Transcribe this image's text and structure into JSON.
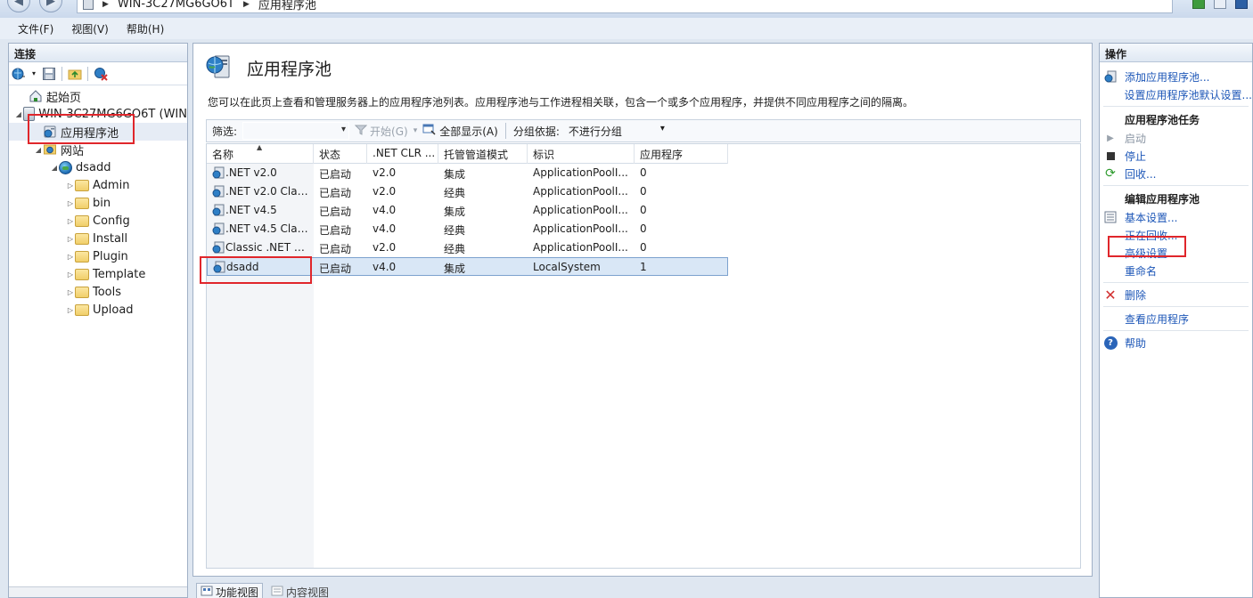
{
  "address": {
    "segments": [
      "WIN-3C27MG6GO6T",
      "应用程序池"
    ]
  },
  "menu": [
    "文件(F)",
    "视图(V)",
    "帮助(H)"
  ],
  "connections": {
    "title": "连接",
    "tree": {
      "start_page": "起始页",
      "server": "WIN-3C27MG6GO6T (WIN",
      "app_pools": "应用程序池",
      "sites": "网站",
      "site_name": "dsadd",
      "folders": [
        "Admin",
        "bin",
        "Config",
        "Install",
        "Plugin",
        "Template",
        "Tools",
        "Upload"
      ]
    }
  },
  "center": {
    "title": "应用程序池",
    "description": "您可以在此页上查看和管理服务器上的应用程序池列表。应用程序池与工作进程相关联，包含一个或多个应用程序，并提供不同应用程序之间的隔离。",
    "filter": {
      "label": "筛选:",
      "go": "开始(G)",
      "show_all": "全部显示(A)",
      "group_by_label": "分组依据:",
      "group_by_value": "不进行分组"
    },
    "columns": [
      "名称",
      "状态",
      ".NET CLR ...",
      "托管管道模式",
      "标识",
      "应用程序"
    ],
    "rows": [
      {
        "name": ".NET v2.0",
        "status": "已启动",
        "clr": "v2.0",
        "pipeline": "集成",
        "identity": "ApplicationPoolI...",
        "apps": "0"
      },
      {
        "name": ".NET v2.0 Clas...",
        "status": "已启动",
        "clr": "v2.0",
        "pipeline": "经典",
        "identity": "ApplicationPoolI...",
        "apps": "0"
      },
      {
        "name": ".NET v4.5",
        "status": "已启动",
        "clr": "v4.0",
        "pipeline": "集成",
        "identity": "ApplicationPoolI...",
        "apps": "0"
      },
      {
        "name": ".NET v4.5 Clas...",
        "status": "已启动",
        "clr": "v4.0",
        "pipeline": "经典",
        "identity": "ApplicationPoolI...",
        "apps": "0"
      },
      {
        "name": "Classic .NET A...",
        "status": "已启动",
        "clr": "v2.0",
        "pipeline": "经典",
        "identity": "ApplicationPoolI...",
        "apps": "0"
      },
      {
        "name": "dsadd",
        "status": "已启动",
        "clr": "v4.0",
        "pipeline": "集成",
        "identity": "LocalSystem",
        "apps": "1"
      }
    ],
    "selected_row": "dsadd",
    "tabs": {
      "features": "功能视图",
      "content": "内容视图"
    }
  },
  "actions": {
    "title": "操作",
    "add_pool": "添加应用程序池...",
    "set_defaults": "设置应用程序池默认设置...",
    "tasks_header": "应用程序池任务",
    "start": "启动",
    "stop": "停止",
    "recycle": "回收...",
    "edit_header": "编辑应用程序池",
    "basic_settings": "基本设置...",
    "recycling": "正在回收...",
    "advanced_settings": "高级设置...",
    "rename": "重命名",
    "delete": "删除",
    "view_apps": "查看应用程序",
    "help": "帮助"
  },
  "colors": {
    "highlight_red": "#e0262b",
    "link_blue": "#1c56b7",
    "selection": "#d9e7f6"
  }
}
